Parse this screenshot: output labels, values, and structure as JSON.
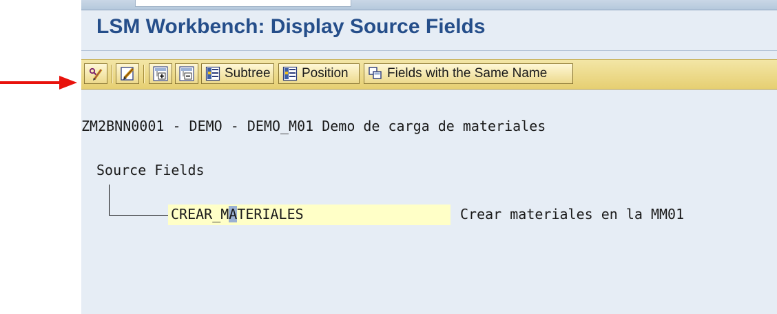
{
  "window": {
    "title": "LSM Workbench: Display Source Fields"
  },
  "toolbar": {
    "buttons": [
      {
        "icon": "display-change-icon"
      },
      {
        "icon": "edit-pencil-icon"
      },
      {
        "icon": "expand-subtree-icon"
      },
      {
        "icon": "collapse-subtree-icon"
      },
      {
        "icon": "subtree-icon",
        "label": "Subtree"
      },
      {
        "icon": "position-icon",
        "label": "Position"
      },
      {
        "icon": "same-name-fields-icon",
        "label": "Fields with the Same Name"
      }
    ]
  },
  "main": {
    "header_line": "ZM2BNN0001 - DEMO - DEMO_M01 Demo de carga de materiales",
    "tree": {
      "root_label": "Source Fields",
      "node": {
        "name_before_cursor": "CREAR_M",
        "cursor_char": "A",
        "name_after_cursor": "TERIALES",
        "description": "Crear materiales en la MM01"
      }
    }
  },
  "colors": {
    "title": "#254e8a",
    "toolbar": "#e9d37a",
    "background": "#e6edf5",
    "field_highlight": "#ffffc7",
    "cursor": "#9ab0d2",
    "annotation_arrow": "#e8120c"
  }
}
